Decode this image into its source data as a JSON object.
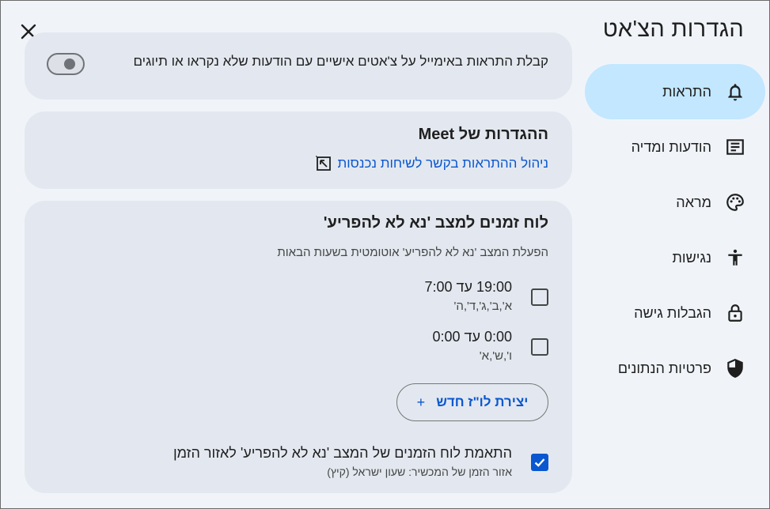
{
  "header": {
    "title": "הגדרות הצ'אט"
  },
  "sidebar": {
    "items": [
      {
        "label": "התראות",
        "icon": "bell-icon",
        "active": true
      },
      {
        "label": "הודעות ומדיה",
        "icon": "message-icon",
        "active": false
      },
      {
        "label": "מראה",
        "icon": "palette-icon",
        "active": false
      },
      {
        "label": "נגישות",
        "icon": "accessibility-icon",
        "active": false
      },
      {
        "label": "הגבלות גישה",
        "icon": "lock-icon",
        "active": false
      },
      {
        "label": "פרטיות הנתונים",
        "icon": "shield-icon",
        "active": false
      }
    ]
  },
  "email_notifications": {
    "label": "קבלת התראות באימייל על צ'אטים אישיים עם הודעות שלא נקראו או תיוגים",
    "enabled": false
  },
  "meet": {
    "heading": "ההגדרות של Meet",
    "link": "ניהול ההתראות בקשר לשיחות נכנסות"
  },
  "dnd": {
    "heading": "לוח זמנים למצב 'נא לא להפריע'",
    "description": "הפעלת המצב 'נא לא להפריע' אוטומטית בשעות הבאות",
    "schedules": [
      {
        "time": "19:00 עד 7:00",
        "days": "א',ב',ג',ד',ה'",
        "checked": false
      },
      {
        "time": "0:00 עד 0:00",
        "days": "ו',ש',א'",
        "checked": false
      }
    ],
    "new_button": "יצירת לו\"ז חדש",
    "new_button_icon": "+",
    "timezone_label": "התאמת לוח הזמנים של המצב 'נא לא להפריע' לאזור הזמן",
    "timezone_sub": "אזור הזמן של המכשיר: שעון ישראל (קיץ)",
    "timezone_checked": true
  },
  "colors": {
    "accent": "#0b57d0",
    "active_nav": "#c2e7ff",
    "card": "#e3e8f0",
    "background": "#f0f4f9"
  }
}
